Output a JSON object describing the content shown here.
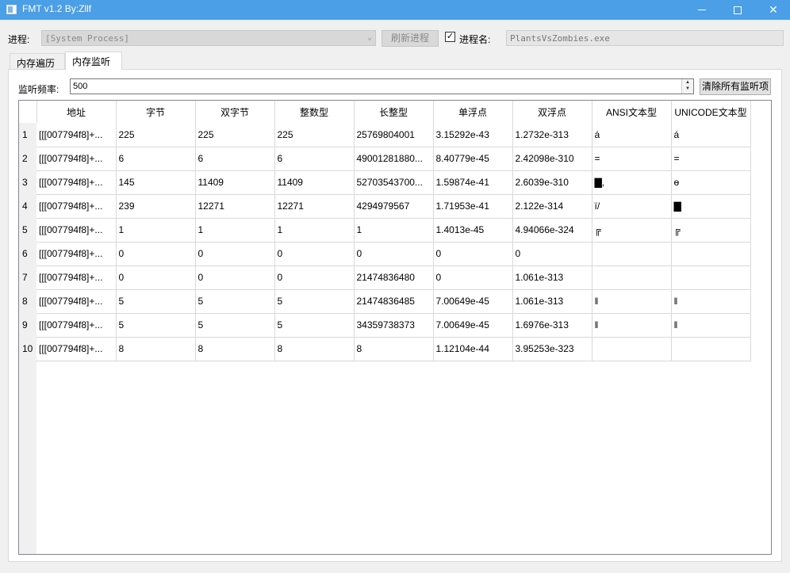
{
  "window": {
    "title": "FMT v1.2 By:Zllf"
  },
  "process": {
    "label": "进程:",
    "selected": "[System Process]",
    "refresh_button": "刷新进程",
    "procname_checkbox_label": "进程名:",
    "procname_checked": true,
    "procname_value": "PlantsVsZombies.exe"
  },
  "tabs": [
    {
      "label": "内存遍历"
    },
    {
      "label": "内存监听"
    }
  ],
  "monitor": {
    "freq_label": "监听频率:",
    "freq_value": "500",
    "clear_button": "清除所有监听项"
  },
  "table": {
    "columns": [
      "地址",
      "字节",
      "双字节",
      "整数型",
      "长整型",
      "单浮点",
      "双浮点",
      "ANSI文本型",
      "UNICODE文本型"
    ],
    "rows": [
      [
        "1",
        "[[[007794f8]+...",
        "225",
        "225",
        "225",
        "25769804001",
        "3.15292e-43",
        "1.2732e-313",
        "á",
        "á"
      ],
      [
        "2",
        "[[[007794f8]+...",
        "6",
        "6",
        "6",
        "49001281880...",
        "8.40779e-45",
        "2.42098e-310",
        "=",
        "="
      ],
      [
        "3",
        "[[[007794f8]+...",
        "145",
        "11409",
        "11409",
        "52703543700...",
        "1.59874e-41",
        "2.6039e-310",
        "▇,",
        "ɵ"
      ],
      [
        "4",
        "[[[007794f8]+...",
        "239",
        "12271",
        "12271",
        "4294979567",
        "1.71953e-41",
        "2.122e-314",
        "ï/",
        "▇"
      ],
      [
        "5",
        "[[[007794f8]+...",
        "1",
        "1",
        "1",
        "1",
        "1.4013e-45",
        "4.94066e-324",
        "╔",
        "╔"
      ],
      [
        "6",
        "[[[007794f8]+...",
        "0",
        "0",
        "0",
        "0",
        "0",
        "0",
        "",
        ""
      ],
      [
        "7",
        "[[[007794f8]+...",
        "0",
        "0",
        "0",
        "21474836480",
        "0",
        "1.061e-313",
        "",
        ""
      ],
      [
        "8",
        "[[[007794f8]+...",
        "5",
        "5",
        "5",
        "21474836485",
        "7.00649e-45",
        "1.061e-313",
        "‖",
        "‖"
      ],
      [
        "9",
        "[[[007794f8]+...",
        "5",
        "5",
        "5",
        "34359738373",
        "7.00649e-45",
        "1.6976e-313",
        "‖",
        "‖"
      ],
      [
        "10",
        "[[[007794f8]+...",
        "8",
        "8",
        "8",
        "8",
        "1.12104e-44",
        "3.95253e-323",
        "",
        ""
      ]
    ]
  }
}
